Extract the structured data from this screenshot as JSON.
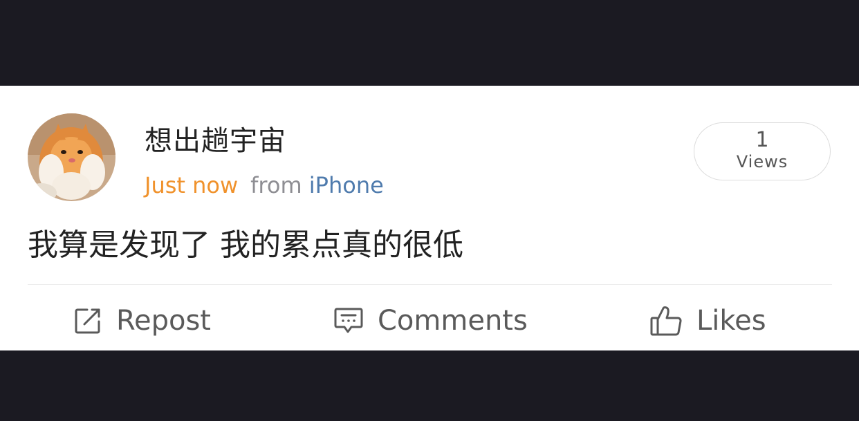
{
  "post": {
    "username": "想出趟宇宙",
    "time": "Just now",
    "from_label": "from",
    "device": "iPhone",
    "views_count": "1",
    "views_label": "Views",
    "content": "我算是发现了 我的累点真的很低"
  },
  "actions": {
    "repost_label": "Repost",
    "comments_label": "Comments",
    "likes_label": "Likes"
  },
  "colors": {
    "background": "#1b1a22",
    "card": "#ffffff",
    "time": "#f0922c",
    "device": "#4f7bad",
    "muted": "#8e8e93"
  },
  "icons": {
    "avatar": "cat-photo-avatar",
    "repost": "edit-square-icon",
    "comments": "comment-bubble-icon",
    "likes": "thumbs-up-icon"
  }
}
